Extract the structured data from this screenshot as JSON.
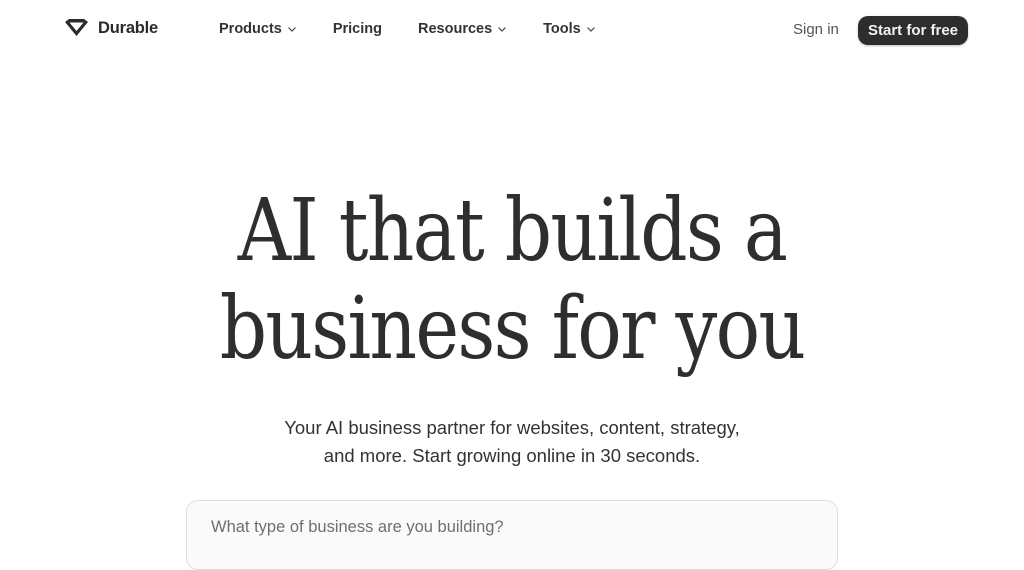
{
  "brand": {
    "name": "Durable",
    "logo_icon": "diamond-logo-icon"
  },
  "nav": {
    "items": [
      {
        "label": "Products",
        "has_dropdown": true
      },
      {
        "label": "Pricing",
        "has_dropdown": false
      },
      {
        "label": "Resources",
        "has_dropdown": true
      },
      {
        "label": "Tools",
        "has_dropdown": true
      }
    ],
    "sign_in": "Sign in",
    "cta": "Start for free"
  },
  "hero": {
    "title_line1": "AI that builds a",
    "title_line2": "business for you",
    "subtitle_line1": "Your AI business partner for websites, content, strategy,",
    "subtitle_line2": "and more. Start growing online in 30 seconds."
  },
  "search": {
    "placeholder": "What type of business are you building?",
    "value": ""
  },
  "colors": {
    "cta_background": "#2d2d2d",
    "text": "#2e2e2e",
    "background": "#ffffff"
  }
}
